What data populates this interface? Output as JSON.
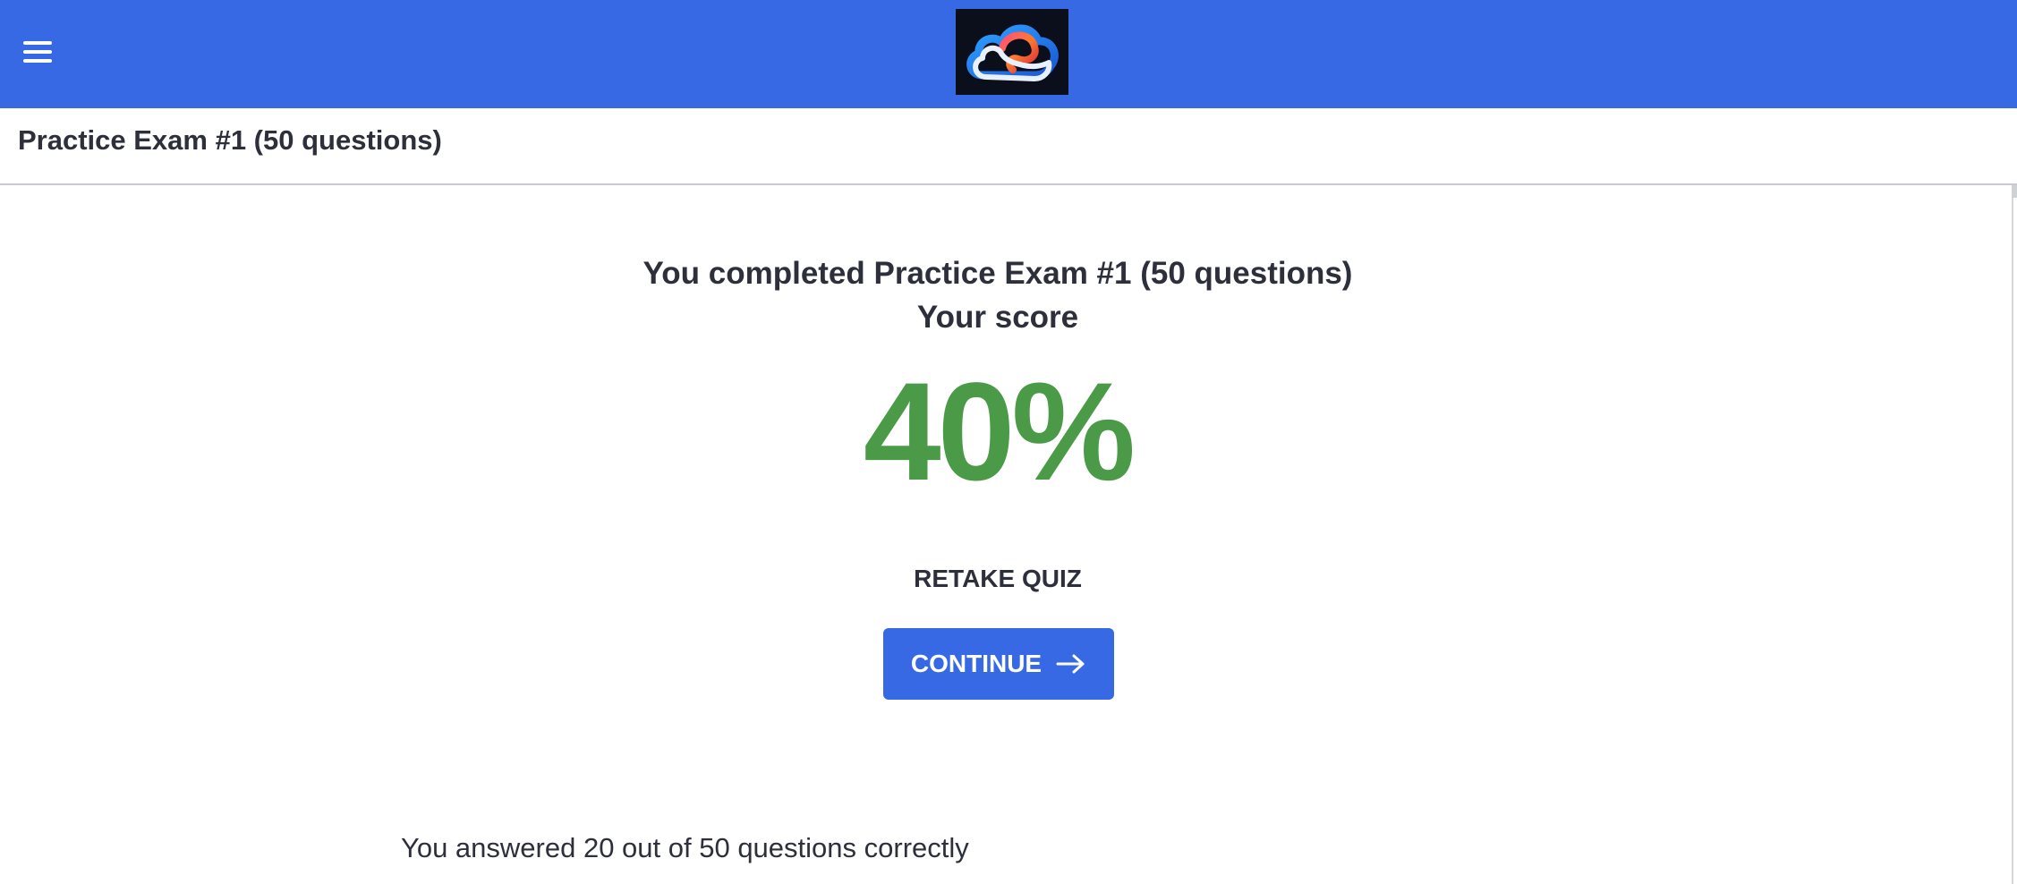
{
  "header": {
    "menu_icon": "hamburger-menu-icon",
    "logo_icon": "cloud-logo-icon",
    "brand_color": "#3869e4"
  },
  "course": {
    "title": "Practice Exam #1 (50 questions)"
  },
  "result": {
    "completed_text": "You completed Practice Exam #1 (50 questions)",
    "score_label": "Your score",
    "score_value": "40%",
    "score_color": "#4a9a48",
    "summary": "You answered 20 out of 50 questions correctly",
    "correct_count": 20,
    "total_count": 50
  },
  "actions": {
    "retake_label": "RETAKE QUIZ",
    "continue_label": "CONTINUE",
    "continue_icon": "arrow-right-icon"
  }
}
